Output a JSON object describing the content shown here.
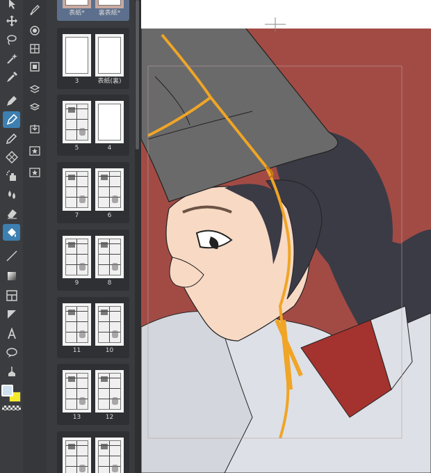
{
  "toolbar": {
    "tools": [
      "operation-tool",
      "move-tool",
      "lasso-select-tool",
      "auto-select-tool",
      "eyedropper-tool",
      "pen-tool",
      "marker-tool",
      "pencil-tool",
      "decoration-tool",
      "airbrush-tool",
      "blend-tool",
      "eraser-tool",
      "fill-tool",
      "line-tool",
      "gradient-tool",
      "frame-tool",
      "ruler-tool",
      "text-tool",
      "balloon-tool",
      "correction-tool"
    ],
    "active_tool": "fill-tool",
    "main_color": "#cfe0ee",
    "sub_color": "#f6ec2c"
  },
  "command_bar": {
    "icons": [
      "brush-settings-icon",
      "stack-icon",
      "grid-icon",
      "film-icon",
      "layer-move-icon",
      "layers-icon",
      "import-icon",
      "favorites-icon",
      "favorites-2-icon"
    ]
  },
  "pages_panel": {
    "spreads": [
      {
        "left_label": "表紙*",
        "right_label": "裏表紙*",
        "selected": true
      },
      {
        "left_label": "3",
        "right_label": "表紙(裏)",
        "manga": false
      },
      {
        "left_label": "5",
        "right_label": "4",
        "manga": true,
        "right_blank": true
      },
      {
        "left_label": "7",
        "right_label": "6",
        "manga": true
      },
      {
        "left_label": "9",
        "right_label": "8",
        "manga": true
      },
      {
        "left_label": "11",
        "right_label": "10",
        "manga": true
      },
      {
        "left_label": "13",
        "right_label": "12",
        "manga": true
      },
      {
        "left_label": "",
        "right_label": "",
        "manga": true
      }
    ]
  },
  "canvas": {
    "background_color": "#a24b45",
    "hat_color": "#6a6a6a",
    "cord_color": "#f0a526",
    "hair_color": "#3b3b46",
    "skin_color": "#f7d9c4",
    "robe_color": "#dde0e6"
  }
}
